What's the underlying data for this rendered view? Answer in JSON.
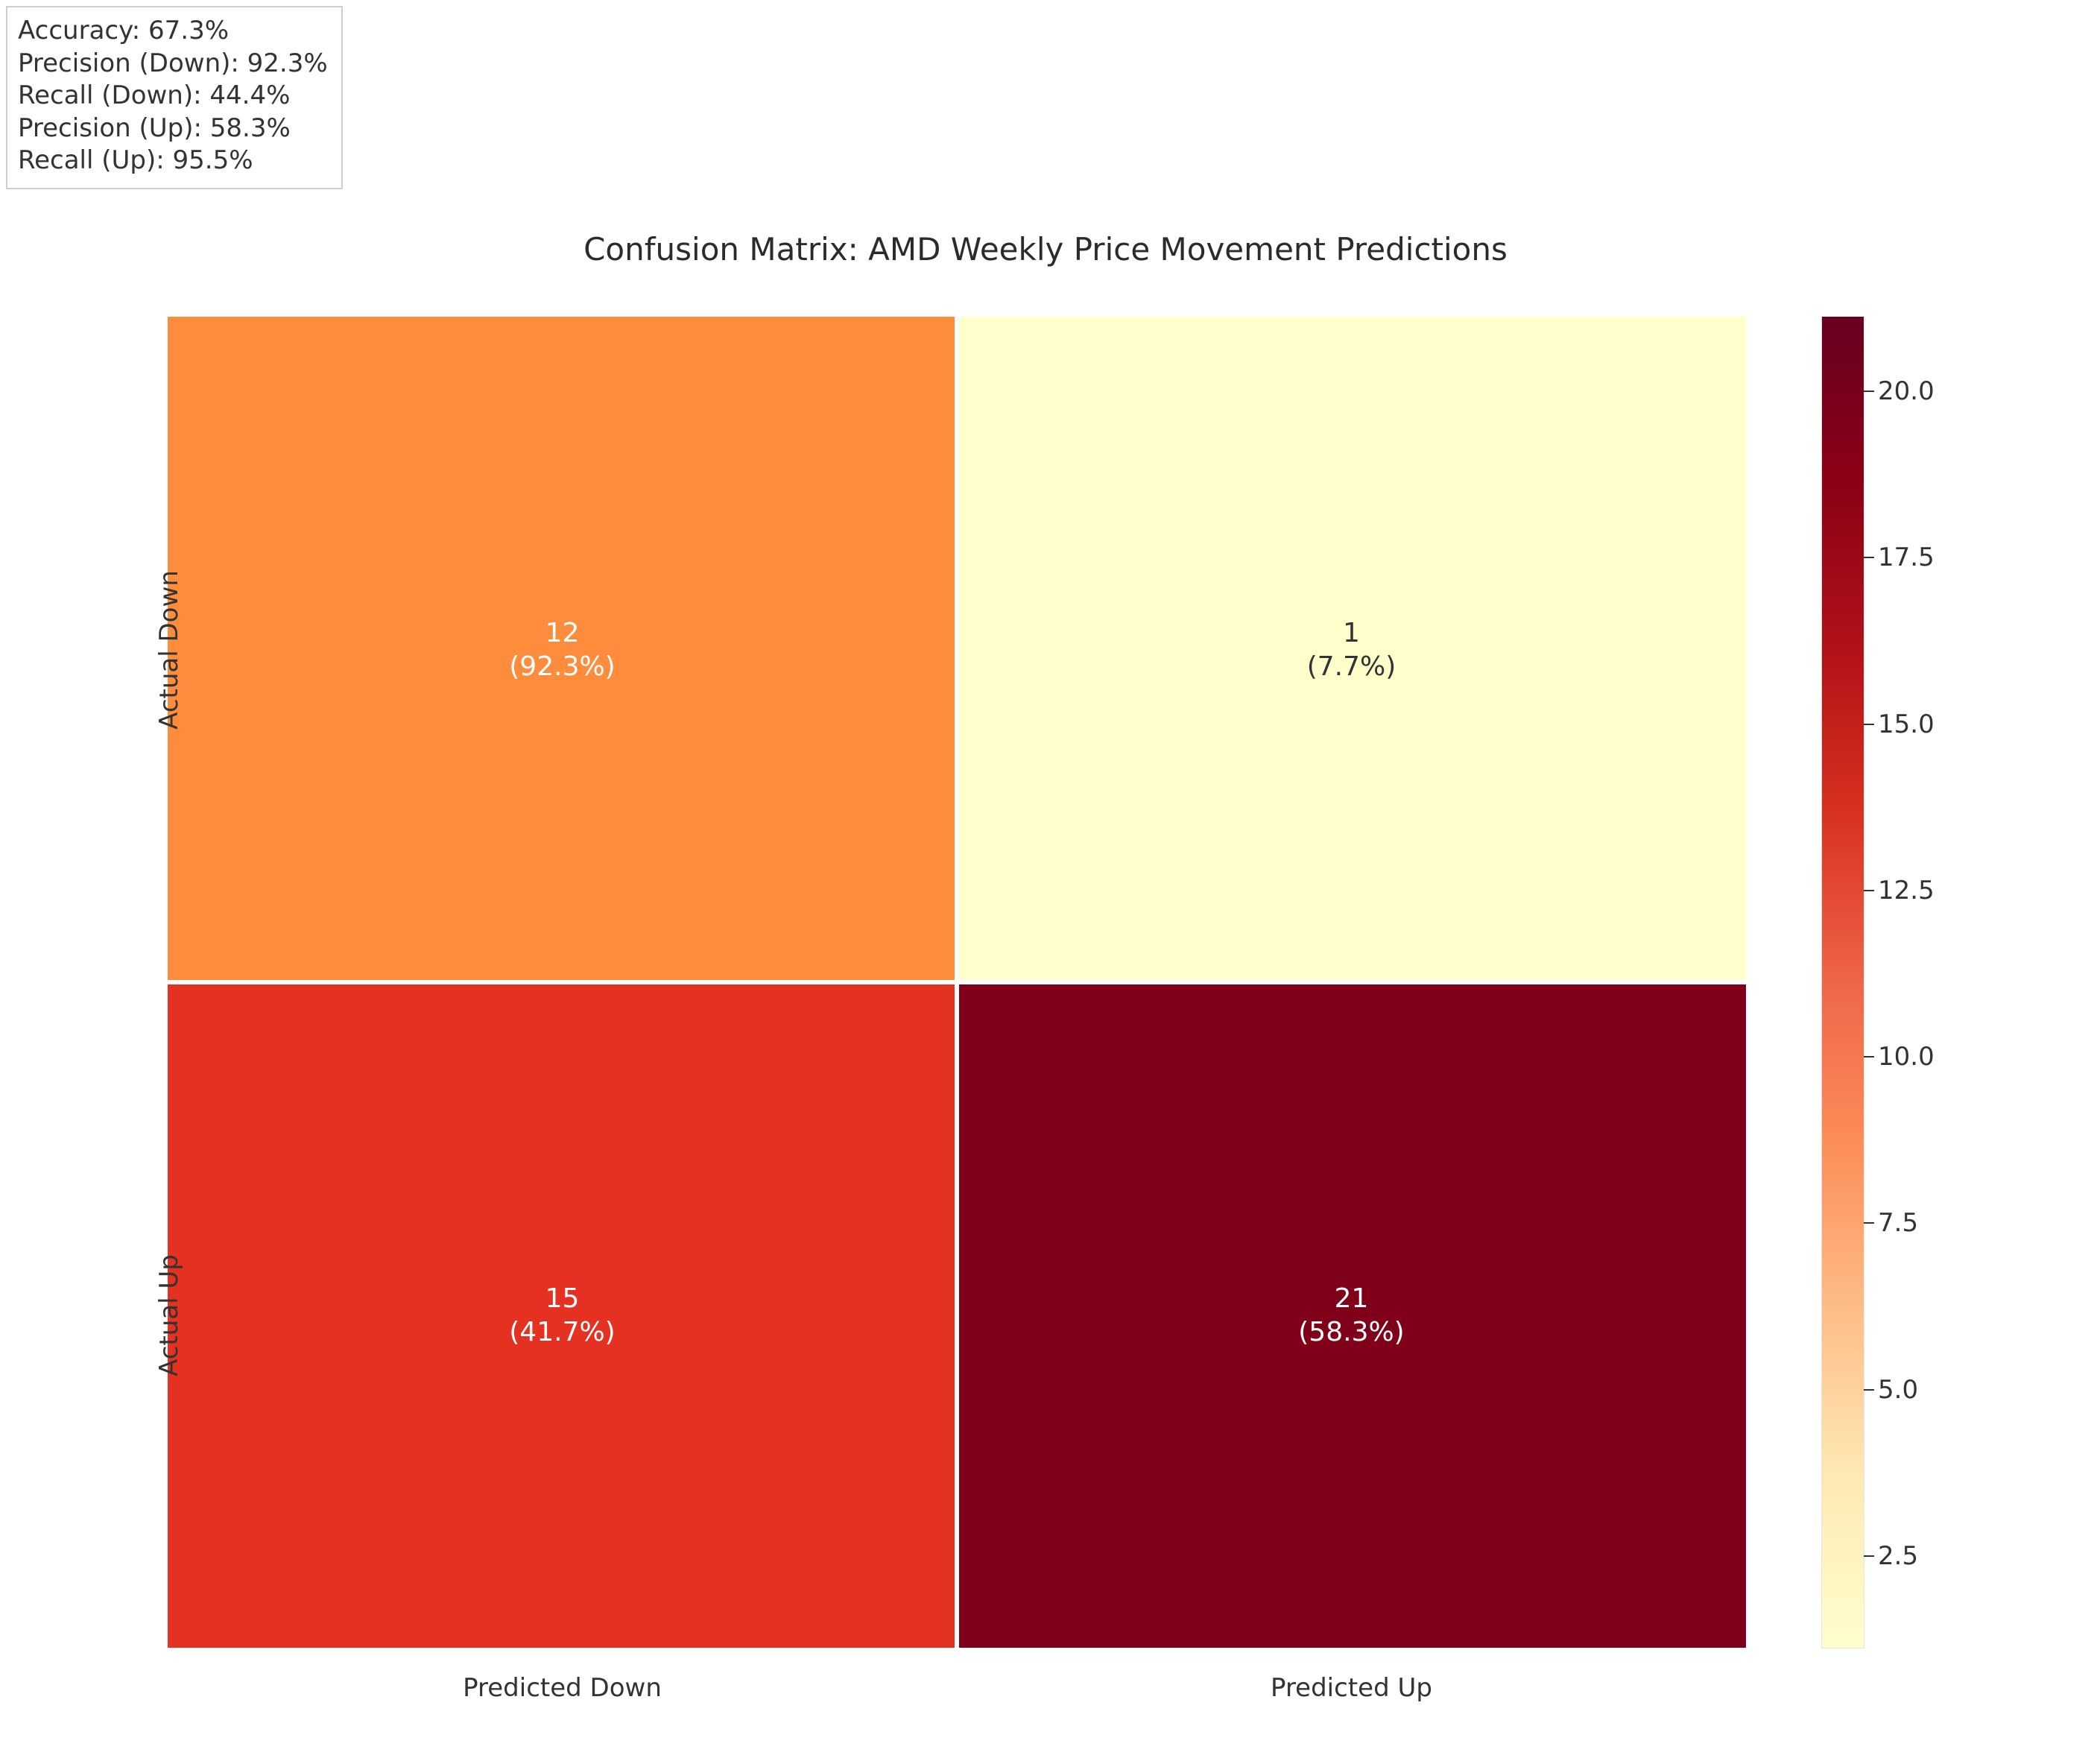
{
  "metrics": {
    "accuracy": "Accuracy: 67.3%",
    "precision_down": "Precision (Down): 92.3%",
    "recall_down": "Recall (Down): 44.4%",
    "precision_up": "Precision (Up): 58.3%",
    "recall_up": "Recall (Up): 95.5%"
  },
  "title": "Confusion Matrix: AMD Weekly Price Movement Predictions",
  "xlabels": [
    "Predicted Down",
    "Predicted Up"
  ],
  "ylabels": [
    "Actual Down",
    "Actual Up"
  ],
  "cells": {
    "r0c0": {
      "count": "12",
      "pct": "(92.3%)",
      "bg": "#fd8d3c",
      "fg": "#ffffff"
    },
    "r0c1": {
      "count": "1",
      "pct": "(7.7%)",
      "bg": "#ffffcc",
      "fg": "#333333"
    },
    "r1c0": {
      "count": "15",
      "pct": "(41.7%)",
      "bg": "#e43121",
      "fg": "#ffffff"
    },
    "r1c1": {
      "count": "21",
      "pct": "(58.3%)",
      "bg": "#7f0018",
      "fg": "#ffffff"
    }
  },
  "colorbar_ticks": [
    {
      "label": "20.0",
      "pos_pct": 5.6
    },
    {
      "label": "17.5",
      "pos_pct": 18.1
    },
    {
      "label": "15.0",
      "pos_pct": 30.6
    },
    {
      "label": "12.5",
      "pos_pct": 43.1
    },
    {
      "label": "10.0",
      "pos_pct": 55.6
    },
    {
      "label": "7.5",
      "pos_pct": 68.1
    },
    {
      "label": "5.0",
      "pos_pct": 80.6
    },
    {
      "label": "2.5",
      "pos_pct": 93.1
    }
  ],
  "chart_data": {
    "type": "heatmap",
    "title": "Confusion Matrix: AMD Weekly Price Movement Predictions",
    "xlabel": "",
    "ylabel": "",
    "x_categories": [
      "Predicted Down",
      "Predicted Up"
    ],
    "y_categories": [
      "Actual Down",
      "Actual Up"
    ],
    "values": [
      [
        12,
        1
      ],
      [
        15,
        21
      ]
    ],
    "row_percentages": [
      [
        92.3,
        7.7
      ],
      [
        41.7,
        58.3
      ]
    ],
    "colorbar": {
      "min": 1,
      "max": 21,
      "ticks": [
        2.5,
        5.0,
        7.5,
        10.0,
        12.5,
        15.0,
        17.5,
        20.0
      ],
      "cmap": "YlOrRd"
    },
    "annotations": {
      "Accuracy": 67.3,
      "Precision (Down)": 92.3,
      "Recall (Down)": 44.4,
      "Precision (Up)": 58.3,
      "Recall (Up)": 95.5
    }
  }
}
